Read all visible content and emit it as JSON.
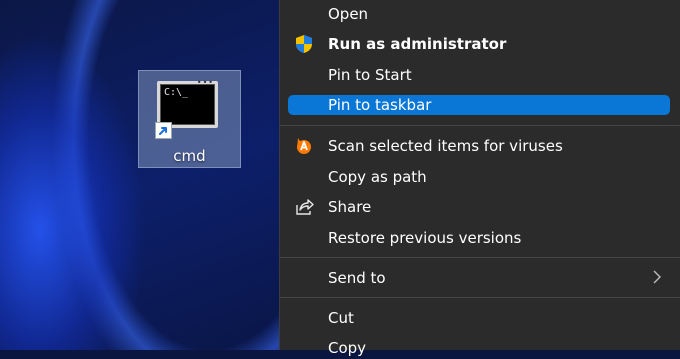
{
  "desktop": {
    "shortcut": {
      "label": "cmd",
      "prompt_text": "C:\\_",
      "icon": "command-prompt-icon"
    }
  },
  "context_menu": {
    "items": [
      {
        "label": "Open",
        "icon": null
      },
      {
        "label": "Run as administrator",
        "icon": "uac-shield-icon",
        "bold": true
      },
      {
        "label": "Pin to Start",
        "icon": null
      },
      {
        "label": "Pin to taskbar",
        "icon": null,
        "highlighted": true
      },
      {
        "label": "Scan selected items for viruses",
        "icon": "avast-icon"
      },
      {
        "label": "Copy as path",
        "icon": null
      },
      {
        "label": "Share",
        "icon": "share-icon"
      },
      {
        "label": "Restore previous versions",
        "icon": null
      },
      {
        "label": "Send to",
        "icon": null,
        "submenu": true
      },
      {
        "label": "Cut",
        "icon": null
      },
      {
        "label": "Copy",
        "icon": null
      }
    ],
    "colors": {
      "background": "#2b2b2b",
      "highlight": "#0a76d6",
      "text": "#ffffff"
    }
  }
}
